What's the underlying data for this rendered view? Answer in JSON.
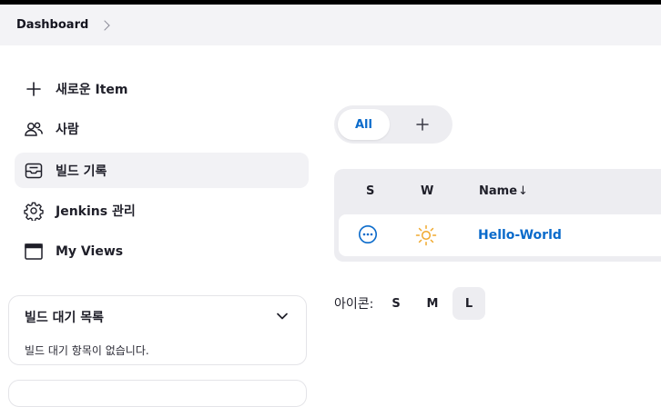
{
  "breadcrumb": {
    "items": [
      "Dashboard"
    ]
  },
  "sidebar": {
    "items": [
      {
        "label": "새로운 Item",
        "icon": "plus-icon"
      },
      {
        "label": "사람",
        "icon": "people-icon"
      },
      {
        "label": "빌드 기록",
        "icon": "inbox-icon",
        "active": true
      },
      {
        "label": "Jenkins 관리",
        "icon": "gear-icon"
      },
      {
        "label": "My Views",
        "icon": "window-icon"
      }
    ]
  },
  "build_queue": {
    "title": "빌드 대기 목록",
    "empty_text": "빌드 대기 항목이 없습니다."
  },
  "views": {
    "tabs": [
      {
        "label": "All",
        "selected": true
      }
    ]
  },
  "jobs_table": {
    "columns": {
      "status": "S",
      "weather": "W",
      "name": "Name",
      "sort_indicator": "↓"
    },
    "rows": [
      {
        "name": "Hello-World",
        "status_icon": "status-not-built-icon",
        "weather_icon": "sunny-icon"
      }
    ]
  },
  "icon_size": {
    "label": "아이콘:",
    "options": [
      "S",
      "M",
      "L"
    ],
    "selected": "L"
  },
  "colors": {
    "link": "#0b6bcb",
    "sunny": "#f0a92e",
    "panel": "#ededf1"
  }
}
